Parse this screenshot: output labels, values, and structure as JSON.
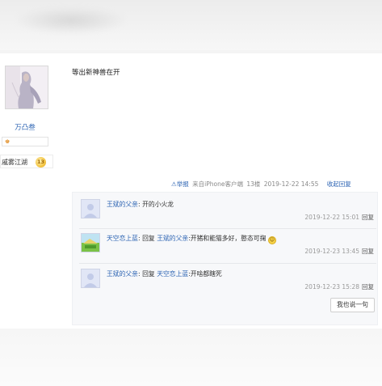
{
  "author": {
    "name": "万凸叁",
    "badge_icon": "crown-badge-icon",
    "level_name": "戚雾江湖",
    "level": "13"
  },
  "post": {
    "content": "等出新神兽在开",
    "meta": {
      "report": "⚠举报",
      "source": "来自iPhone客户端",
      "floor": "13楼",
      "time": "2019-12-22 14:55",
      "collapse": "收起回复"
    }
  },
  "replies": [
    {
      "user": "王斌的父亲",
      "sep": ":",
      "text": "开的小火龙",
      "time": "2019-12-22 15:01",
      "reply_label": "回复"
    },
    {
      "user": "天空恋上蓝",
      "pre": ":",
      "reply_word": "回复",
      "target": "王斌的父亲",
      "text": ":开猪和能猫多好，憨态可掬",
      "time": "2019-12-23 13:45",
      "reply_label": "回复"
    },
    {
      "user": "王斌的父亲",
      "pre": ":",
      "reply_word": "回复",
      "target": "天空恋上蓝",
      "text": ":开啥都瞎死",
      "time": "2019-12-23 15:28",
      "reply_label": "回复"
    }
  ],
  "say_button": "我也说一句",
  "colors": {
    "link": "#2d64b3",
    "meta": "#888888",
    "reply_bg": "#f7f8fa"
  }
}
